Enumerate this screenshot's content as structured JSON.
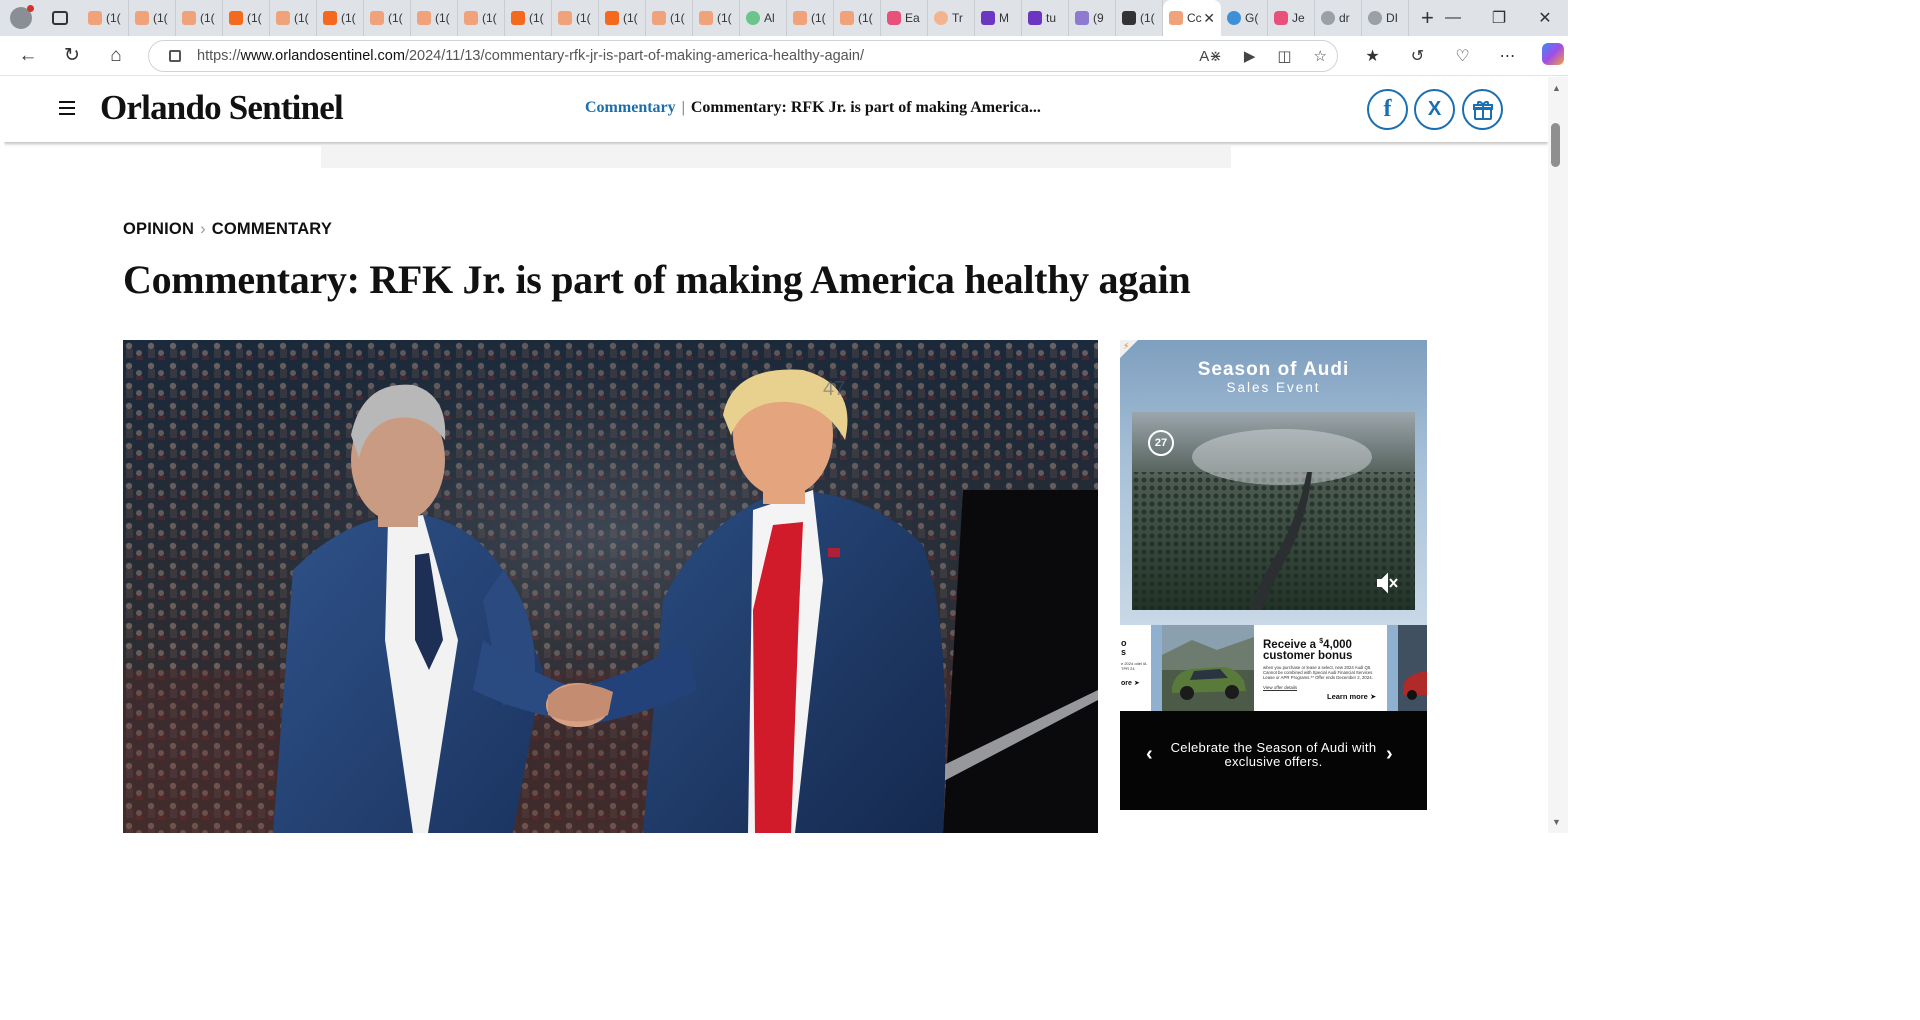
{
  "browser": {
    "tabs": [
      {
        "label": "(1(",
        "icon": "bookmark-icon"
      },
      {
        "label": "(1(",
        "icon": "bookmark-icon"
      },
      {
        "label": "(1(",
        "icon": "bookmark-icon"
      },
      {
        "label": "(1(",
        "icon": "bookmark-icon"
      },
      {
        "label": "(1(",
        "icon": "bookmark-icon"
      },
      {
        "label": "(1(",
        "icon": "bookmark-icon"
      },
      {
        "label": "(1(",
        "icon": "bookmark-icon"
      },
      {
        "label": "(1(",
        "icon": "bookmark-icon"
      },
      {
        "label": "(1(",
        "icon": "bookmark-icon"
      },
      {
        "label": "(1(",
        "icon": "bookmark-icon"
      },
      {
        "label": "(1(",
        "icon": "bookmark-icon"
      },
      {
        "label": "(1(",
        "icon": "bookmark-icon"
      },
      {
        "label": "(1(",
        "icon": "bookmark-icon"
      },
      {
        "label": "(1(",
        "icon": "bookmark-icon"
      },
      {
        "label": "Al",
        "icon": "play-icon"
      },
      {
        "label": "(1(",
        "icon": "bookmark-icon"
      },
      {
        "label": "(1(",
        "icon": "bookmark-icon"
      },
      {
        "label": "Ea",
        "icon": "video-icon"
      },
      {
        "label": "Tr",
        "icon": "circle-icon"
      },
      {
        "label": "M",
        "icon": "yahoo-icon"
      },
      {
        "label": "tu",
        "icon": "yahoo-icon"
      },
      {
        "label": "(9",
        "icon": "mail-icon"
      },
      {
        "label": "(1(",
        "icon": "thumbnail-icon"
      },
      {
        "label": "Cc",
        "icon": "page-icon",
        "active": true
      },
      {
        "label": "G(",
        "icon": "translate-icon"
      },
      {
        "label": "Je",
        "icon": "video-icon"
      },
      {
        "label": "dr",
        "icon": "search-icon"
      },
      {
        "label": "DI",
        "icon": "slash-icon"
      }
    ],
    "url_prefix": "https://",
    "url_host": "www.orlandosentinel.com",
    "url_path": "/2024/11/13/commentary-rfk-jr-is-part-of-making-america-healthy-again/"
  },
  "site": {
    "logo": "Orlando Sentinel",
    "header_section": "Commentary",
    "header_title": "Commentary: RFK Jr. is part of making America...",
    "social": {
      "facebook": "f",
      "x": "X"
    }
  },
  "article": {
    "breadcrumb": [
      "OPINION",
      "COMMENTARY"
    ],
    "headline": "Commentary: RFK Jr. is part of making America healthy again"
  },
  "ad": {
    "title": "Season of Audi",
    "subtitle": "Sales Event",
    "badge": "27",
    "left_card": {
      "line1": "o",
      "line2": "s",
      "fine": "e 2024 odel iA TPR 24",
      "link": "ore"
    },
    "card_headline_pre": "Receive a ",
    "card_headline_sup": "$",
    "card_headline_amount": "4,000",
    "card_headline_post": "customer bonus",
    "card_fine": "when you purchase or lease a select, new 2024 Audi Q5. Cannot be combined with Special Audi Financial Services Lease or APR Programs.** Offer ends December 2, 2024.",
    "card_details": "View offer details",
    "card_learn_more": "Learn more",
    "carousel_text": "Celebrate the Season of Audi with exclusive offers."
  },
  "colors": {
    "accent": "#1a6fb0",
    "tab_orange": "#f4691d"
  }
}
